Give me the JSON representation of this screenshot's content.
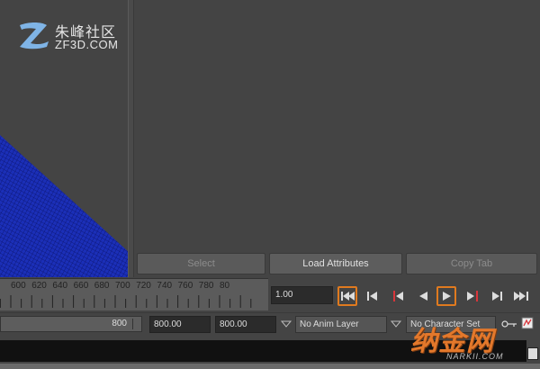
{
  "watermark": {
    "cn": "朱峰社区",
    "en": "ZF3D.COM"
  },
  "watermark2": {
    "cn": "纳金网",
    "en": "NARKII.COM"
  },
  "attribute_editor": {
    "buttons": [
      {
        "label": "Select",
        "enabled": false
      },
      {
        "label": "Load Attributes",
        "enabled": true
      },
      {
        "label": "Copy Tab",
        "enabled": false
      }
    ]
  },
  "time_slider": {
    "tick_labels": [
      "600",
      "620",
      "640",
      "660",
      "680",
      "700",
      "720",
      "740",
      "760",
      "780",
      "80"
    ]
  },
  "playback": {
    "current_frame": "1.00",
    "controls": [
      {
        "name": "go-to-start",
        "icon": "skip-to-start-icon",
        "highlighted": true
      },
      {
        "name": "step-back-frame",
        "icon": "step-back-icon",
        "highlighted": false
      },
      {
        "name": "step-back-key",
        "icon": "step-back-key-icon",
        "highlighted": false
      },
      {
        "name": "play-backwards",
        "icon": "play-backwards-icon",
        "highlighted": false
      },
      {
        "name": "play-forwards",
        "icon": "play-icon",
        "highlighted": true
      },
      {
        "name": "step-forward-key",
        "icon": "step-forward-key-icon",
        "highlighted": false
      },
      {
        "name": "step-forward-frame",
        "icon": "step-forward-icon",
        "highlighted": false
      },
      {
        "name": "go-to-end",
        "icon": "skip-to-end-icon",
        "highlighted": false
      }
    ]
  },
  "range": {
    "range_end_label": "800",
    "start_time": "800.00",
    "end_time": "800.00",
    "anim_layer": "No Anim Layer",
    "character_set": "No Character Set"
  },
  "colors": {
    "highlight": "#e07a1f",
    "mesh": "#1a2bd6",
    "panel": "#444444"
  }
}
